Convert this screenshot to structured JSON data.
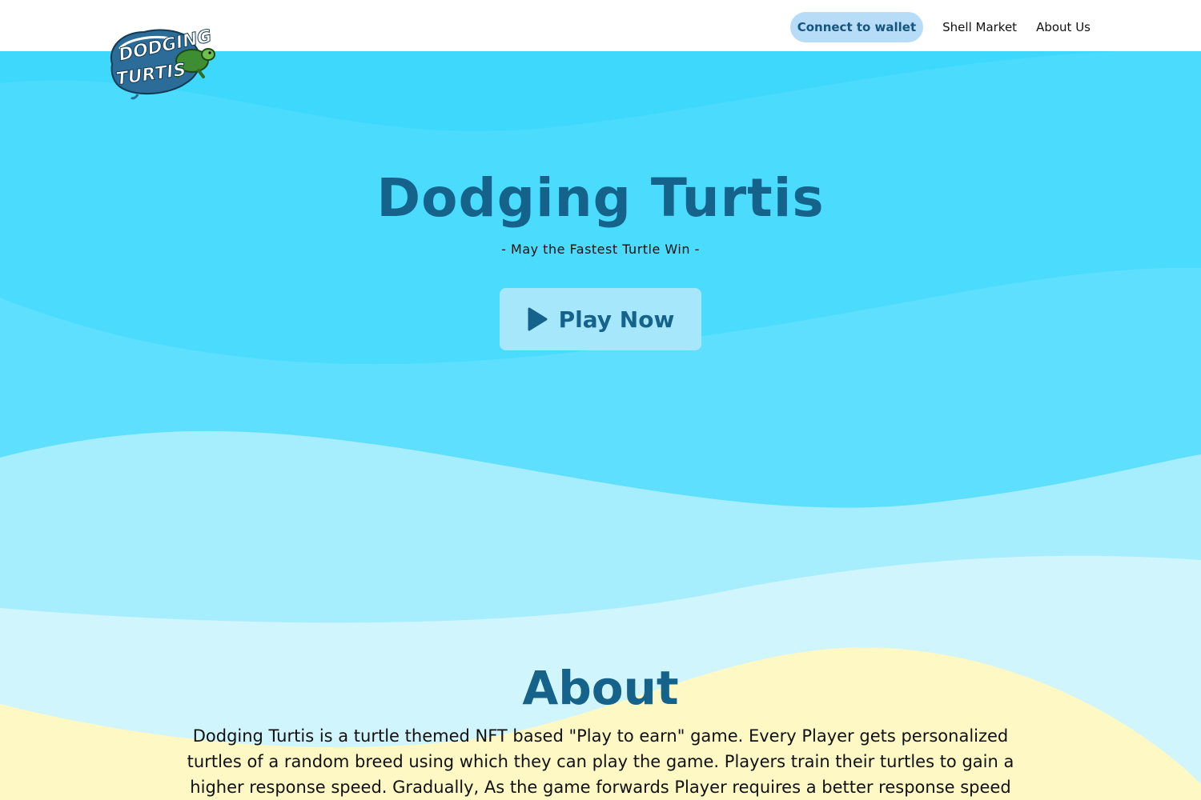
{
  "nav": {
    "logo_alt": "Dodging Turtis",
    "links": [
      {
        "label": "Connect to wallet"
      },
      {
        "label": "Shell Market"
      },
      {
        "label": "About Us"
      }
    ]
  },
  "hero": {
    "title": "Dodging Turtis",
    "tagline": "- May the Fastest Turtle Win -",
    "play_button": {
      "label": "Play Now",
      "icon": "play-icon"
    }
  },
  "about": {
    "title": "About",
    "text": "Dodging Turtis is a turtle themed NFT based \"Play to earn\" game. Every Player gets personalized turtles of a random breed using which they can play the game. Players train their turtles to gain a higher response speed. Gradually, As the game forwards Player requires a better response speed"
  },
  "colors": {
    "accent": "#15628b",
    "ocean_deep": "#3fd8fd",
    "ocean_mid": "#5fdefd",
    "ocean_light": "#a6eefd",
    "ocean_pale": "#d1f5fd",
    "sand": "#fdf8c4",
    "nav_pill": "#b7dcf8"
  }
}
